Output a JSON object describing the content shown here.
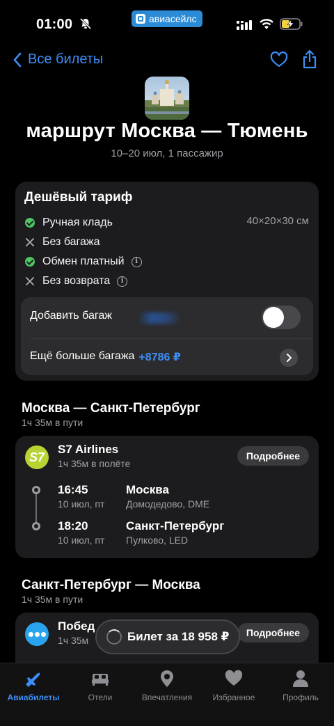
{
  "status": {
    "time": "01:00",
    "brand": "авиасейлс"
  },
  "nav": {
    "back_label": "Все билеты"
  },
  "header": {
    "title": "маршрут Москва — Тюмень",
    "subtitle": "10–20 июл, 1 пассажир"
  },
  "tariff": {
    "title": "Дешёвый тариф",
    "features": [
      {
        "label": "Ручная кладь",
        "included": true
      },
      {
        "label": "Без багажа",
        "included": false
      },
      {
        "label": "Обмен платный",
        "included": true
      },
      {
        "label": "Без возврата",
        "included": false
      }
    ],
    "hand_luggage_size": "40×20×30 см",
    "add_bag_label": "Добавить багаж",
    "add_bag_enabled": false,
    "more_bag_label": "Ещё больше багажа",
    "more_bag_price": "+8786 ₽"
  },
  "segments": [
    {
      "title": "Москва — Санкт-Петербург",
      "duration": "1ч 35м в пути",
      "airline": "S7 Airlines",
      "airline_logo": "S7",
      "flight_duration": "1ч 35м в полёте",
      "details_label": "Подробнее",
      "departure": {
        "time": "16:45",
        "date": "10 июл, пт",
        "city": "Москва",
        "airport": "Домодедово, DME"
      },
      "arrival": {
        "time": "18:20",
        "date": "10 июл, пт",
        "city": "Санкт-Петербург",
        "airport": "Пулково, LED"
      }
    },
    {
      "title": "Санкт-Петербург — Москва",
      "duration": "1ч 35м в пути",
      "airline": "Побед",
      "flight_duration": "1ч 35м",
      "details_label": "Подробнее"
    }
  ],
  "price_pill": {
    "label": "Билет за 18 958 ₽"
  },
  "tabbar": {
    "tabs": [
      {
        "label": "Авиабилеты",
        "icon": "plane-icon",
        "active": true
      },
      {
        "label": "Отели",
        "icon": "bed-icon",
        "active": false
      },
      {
        "label": "Впечатления",
        "icon": "location-pin-icon",
        "active": false
      },
      {
        "label": "Избранное",
        "icon": "heart-icon",
        "active": false
      },
      {
        "label": "Профиль",
        "icon": "person-icon",
        "active": false
      }
    ]
  },
  "colors": {
    "accent": "#3d8ef7",
    "check": "#4fc463",
    "card": "#1c1c1e",
    "s7": "#b7d433",
    "pobeda": "#2aa3ee"
  }
}
